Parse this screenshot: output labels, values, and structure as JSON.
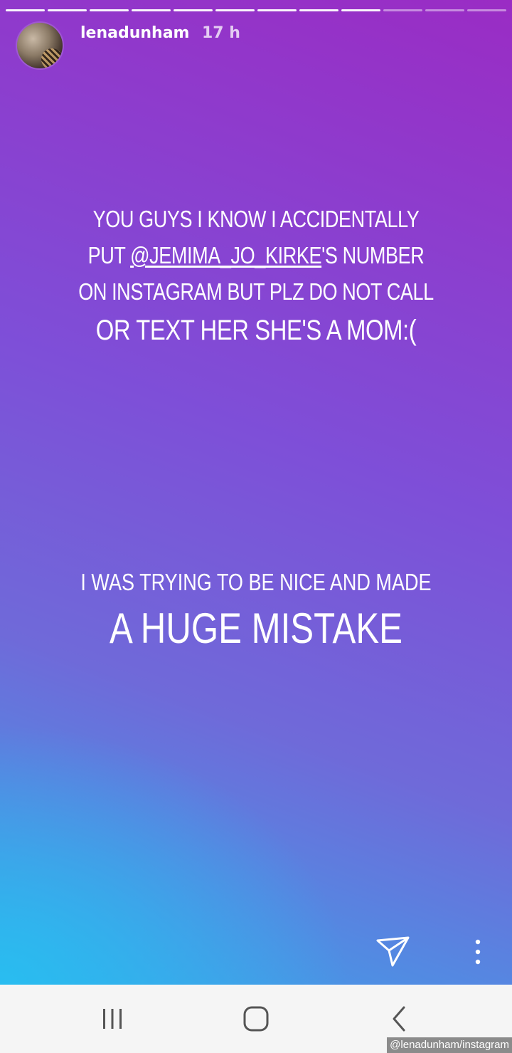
{
  "story": {
    "progress_segments_total": 12,
    "progress_segments_seen": 9,
    "username": "lenadunham",
    "timestamp": "17 h",
    "caption1": {
      "line1": "YOU GUYS I KNOW I ACCIDENTALLY",
      "line2_prefix": "PUT ",
      "line2_mention": "@JEMIMA_JO_KIRKE",
      "line2_suffix": "'S NUMBER",
      "line3": "ON INSTAGRAM BUT PLZ DO NOT CALL",
      "line4": "OR TEXT HER SHE'S A MOM:("
    },
    "caption2": {
      "line1": "I WAS TRYING TO BE NICE AND MADE",
      "line2": "A HUGE MISTAKE"
    },
    "icons": {
      "send": "send-icon",
      "more": "more-vertical-icon"
    }
  },
  "navbar": {
    "icons": [
      "recent-apps-icon",
      "home-icon",
      "back-icon"
    ]
  },
  "credit": "@lenadunham/instagram"
}
